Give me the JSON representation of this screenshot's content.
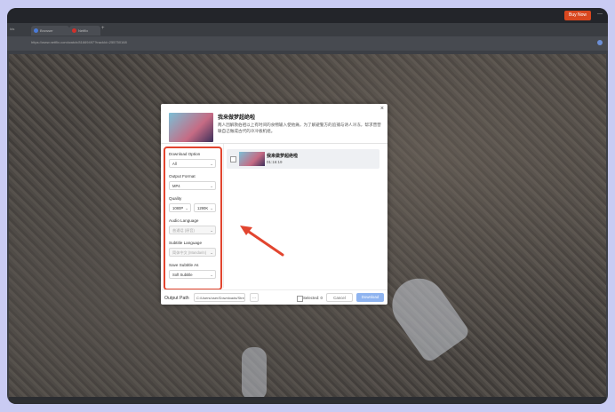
{
  "app": {
    "buy_now_label": "Buy Now",
    "window_controls": "—"
  },
  "tabs": [
    {
      "label": "Browser",
      "color": "#4a7bd8"
    },
    {
      "label": "Netflix",
      "color": "#d0302b"
    }
  ],
  "tab_add_label": "+",
  "sidebar_label": "Ids",
  "address": {
    "url": "https://www.netflix.com/watch/81669497?trackId=255750168"
  },
  "dialog": {
    "close_label": "×",
    "video_title": "我来做梦超绝啦",
    "description": "两人因解救伯祖以上有时间的食物输入使他痛，为了解避警方的追捕与诗人冷冻，帮求营营联自己做成古代的冷冷板机组。",
    "options": {
      "download_option": {
        "label": "Download Option",
        "value": "All"
      },
      "output_format": {
        "label": "Output Format",
        "value": "MP4"
      },
      "quality": {
        "label": "Quality",
        "resolution": "1080P",
        "bitrate": "1290K"
      },
      "audio_language": {
        "label": "Audio Language",
        "value": "普通话 (原音)"
      },
      "subtitle_language": {
        "label": "Subtitle Language",
        "value": "简体中文 (Mandarin)"
      },
      "save_subtitle_as": {
        "label": "Save Subtitle As",
        "value": "Soft Subtitle"
      }
    },
    "video_item": {
      "title": "我来做梦超绝啦",
      "duration": "01:16:19"
    },
    "footer": {
      "output_path_label": "Output Path",
      "output_path_value": "C:/Users/user/Downloads/StreamMedia",
      "folder_icon": "…",
      "selected_label": "Selected: 0",
      "cancel_label": "Cancel",
      "download_label": "Download"
    }
  },
  "colors": {
    "highlight": "#e2452f",
    "accent": "#8fb4f0",
    "buy": "#d9471f"
  }
}
